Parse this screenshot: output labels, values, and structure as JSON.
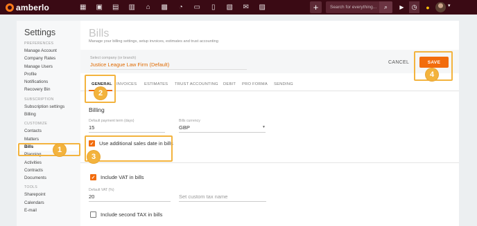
{
  "topbar": {
    "logo_text": "amberlo",
    "nav_icons": [
      "dashboard-icon",
      "contacts-icon",
      "matters-icon",
      "documents-icon",
      "bank-icon",
      "calendar-icon",
      "history-icon",
      "folder-icon",
      "file-icon",
      "invoice-icon",
      "mail-icon",
      "image-icon"
    ],
    "plus_label": "+",
    "search_placeholder": "Search for everything...",
    "search_icon": "search-icon",
    "play_icon": "play-icon",
    "timer_icon": "timer-icon",
    "bell_icon": "bell-icon",
    "avatar": "avatar",
    "caret": "▾"
  },
  "sidebar": {
    "title": "Settings",
    "groups": [
      {
        "label": "PREFERENCES",
        "items": [
          "Manage Account",
          "Company Rates",
          "Manage Users",
          "Profile",
          "Notifications",
          "Recovery Bin"
        ]
      },
      {
        "label": "SUBSCRIPTION",
        "items": [
          "Subscription settings",
          "Billing"
        ]
      },
      {
        "label": "CUSTOMIZE",
        "items": [
          "Contacts",
          "Matters",
          "Bills",
          "Planning",
          "Activities",
          "Contracts",
          "Documents"
        ]
      },
      {
        "label": "TOOLS",
        "items": [
          "Sharepoint",
          "Calendars",
          "E-mail"
        ]
      }
    ],
    "active_item": "Bills"
  },
  "main": {
    "title": "Bills",
    "subtitle": "Manage your billing settings, setup invoices, estimates and trust accounting",
    "company_label": "Select company (or branch)",
    "company_value": "Justice League Law Firm (Default)",
    "cancel_label": "CANCEL",
    "save_label": "SAVE",
    "tabs": [
      "GENERAL",
      "INVOICES",
      "ESTIMATES",
      "TRUST ACCOUNTING",
      "DEBIT",
      "PRO FORMA",
      "SENDING"
    ],
    "active_tab": "GENERAL",
    "billing_title": "Billing",
    "payment_term_label": "Default payment term (days)",
    "payment_term_value": "15",
    "currency_label": "Bills currency",
    "currency_value": "GBP",
    "additional_sales_date_label": "Use additional sales date in bills",
    "additional_sales_date_checked": true,
    "include_vat_label": "Include VAT in bills",
    "include_vat_checked": true,
    "default_vat_label": "Default VAT (%)",
    "default_vat_value": "20",
    "custom_tax_placeholder": "Set custom tax name",
    "second_tax_label": "Include second TAX in bills",
    "second_tax_checked": false
  },
  "annotations": [
    "1",
    "2",
    "3",
    "4"
  ],
  "colors": {
    "accent": "#f26c0d",
    "topbar": "#3a0a14",
    "annotation": "#f3b33d"
  }
}
